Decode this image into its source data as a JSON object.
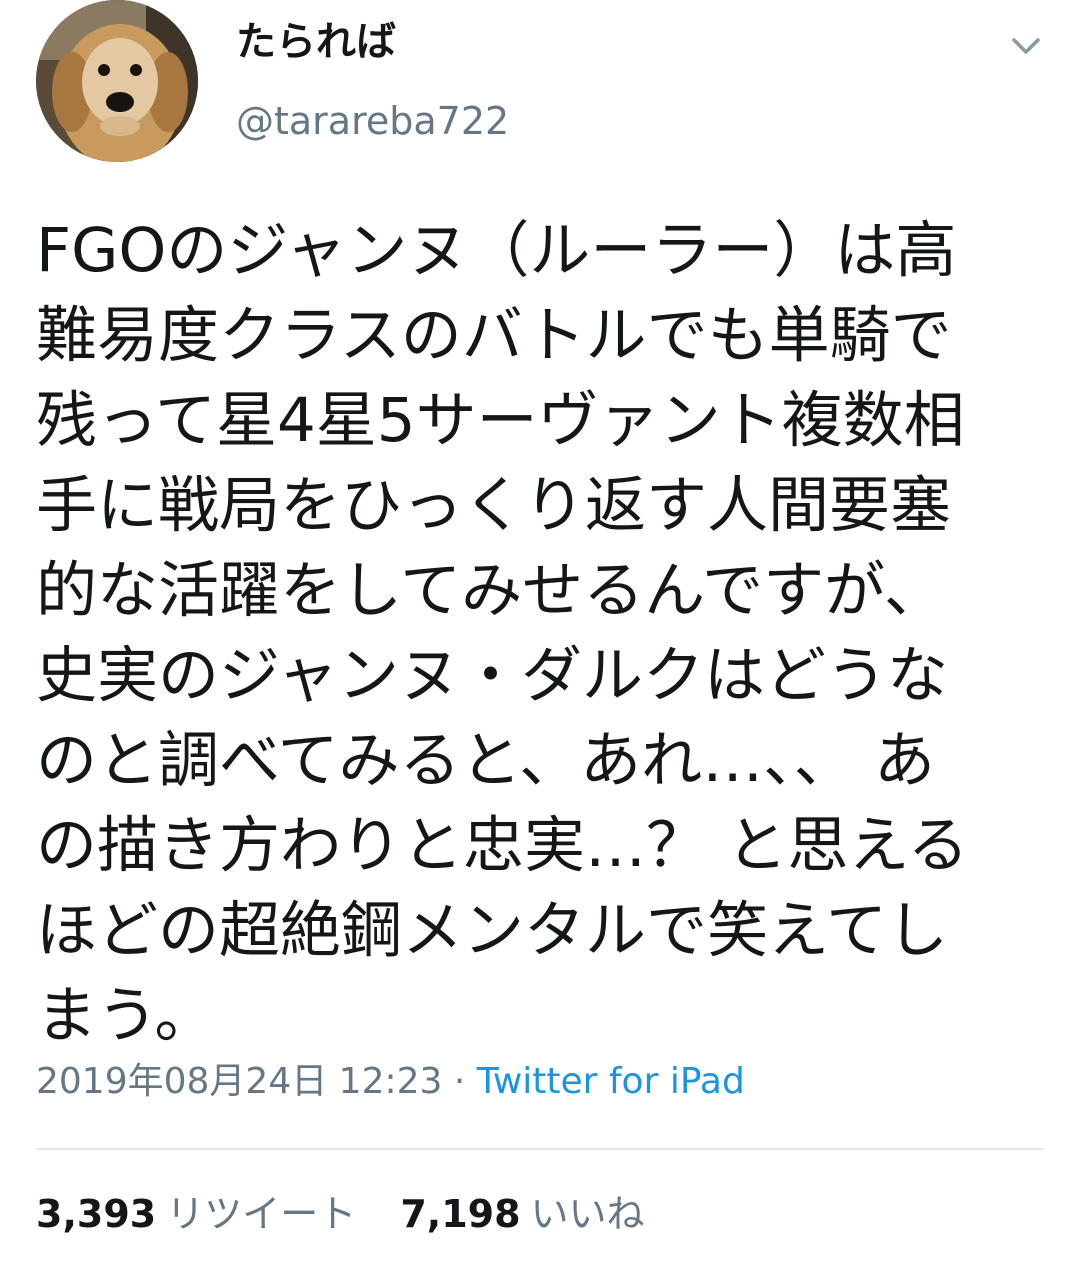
{
  "user": {
    "display_name": "たられば",
    "handle": "@tarareba722",
    "avatar_icon": "dog-avatar-icon",
    "menu_icon": "chevron-down-icon"
  },
  "tweet": {
    "text": "FGOのジャンヌ（ルーラー）は高\n難易度クラスのバトルでも単騎で\n残って星4星5サーヴァント複数相\n手に戦局をひっくり返す人間要塞\n的な活躍をしてみせるんですが、\n史実のジャンヌ・ダルクはどうな\nのと調べてみると、あれ…、、 あ\nの描き方わりと忠実…？ と思える\nほどの超絶鋼メンタルで笑えてし\nまう。",
    "timestamp": "2019年08月24日 12:23",
    "separator": " · ",
    "source": "Twitter for iPad"
  },
  "stats": {
    "retweets_count": "3,393",
    "retweets_label": "リツイート",
    "likes_count": "7,198",
    "likes_label": "いいね"
  },
  "colors": {
    "text": "#14171a",
    "secondary": "#657786",
    "link": "#1b95e0",
    "divider": "#e1e8ed"
  }
}
